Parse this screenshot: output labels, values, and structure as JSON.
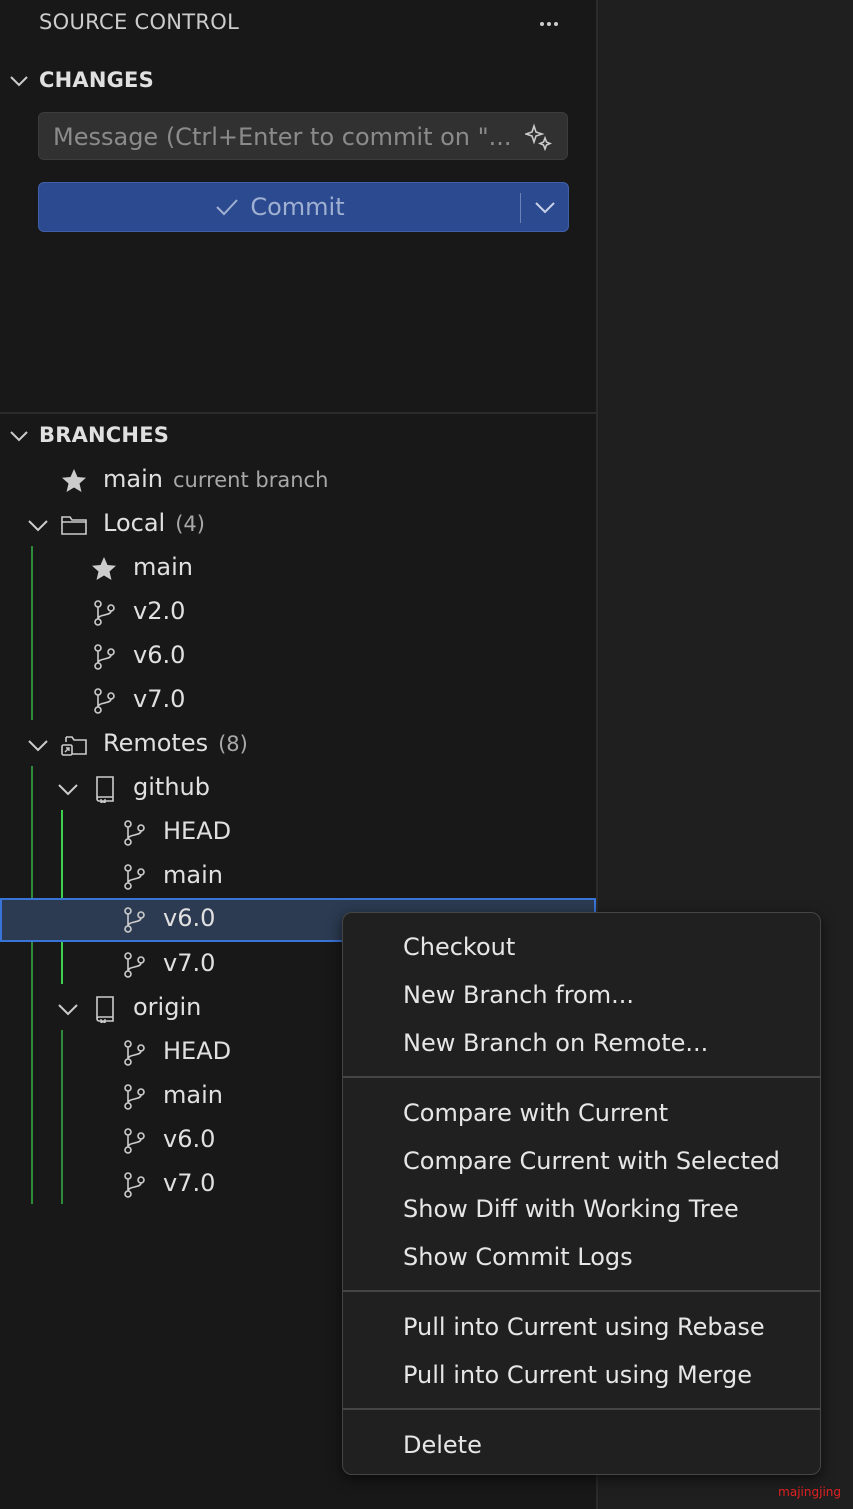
{
  "colors": {
    "accent": "#3874d8",
    "commit_button": "#2c4a8f",
    "guide_local": "#2e8b3c",
    "guide_remote": "#3fcf4e"
  },
  "header": {
    "title": "SOURCE CONTROL",
    "more_icon": "ellipsis-icon"
  },
  "changes": {
    "label": "CHANGES",
    "message_placeholder": "Message (Ctrl+Enter to commit on \"...",
    "commit_label": "Commit"
  },
  "branches": {
    "label": "BRANCHES",
    "current": {
      "name": "main",
      "description": "current branch"
    },
    "local": {
      "label": "Local",
      "count": "(4)",
      "items": [
        {
          "name": "main",
          "icon": "star-icon"
        },
        {
          "name": "v2.0",
          "icon": "git-branch-icon"
        },
        {
          "name": "v6.0",
          "icon": "git-branch-icon"
        },
        {
          "name": "v7.0",
          "icon": "git-branch-icon"
        }
      ]
    },
    "remotes": {
      "label": "Remotes",
      "count": "(8)",
      "groups": [
        {
          "name": "github",
          "items": [
            "HEAD",
            "main",
            "v6.0",
            "v7.0"
          ]
        },
        {
          "name": "origin",
          "items": [
            "HEAD",
            "main",
            "v6.0",
            "v7.0"
          ]
        }
      ]
    }
  },
  "context_menu": {
    "groups": [
      [
        "Checkout",
        "New Branch from...",
        "New Branch on Remote..."
      ],
      [
        "Compare with Current",
        "Compare Current with Selected",
        "Show Diff with Working Tree",
        "Show Commit Logs"
      ],
      [
        "Pull into Current using Rebase",
        "Pull into Current using Merge"
      ],
      [
        "Delete"
      ]
    ]
  },
  "watermark": "majingjing"
}
